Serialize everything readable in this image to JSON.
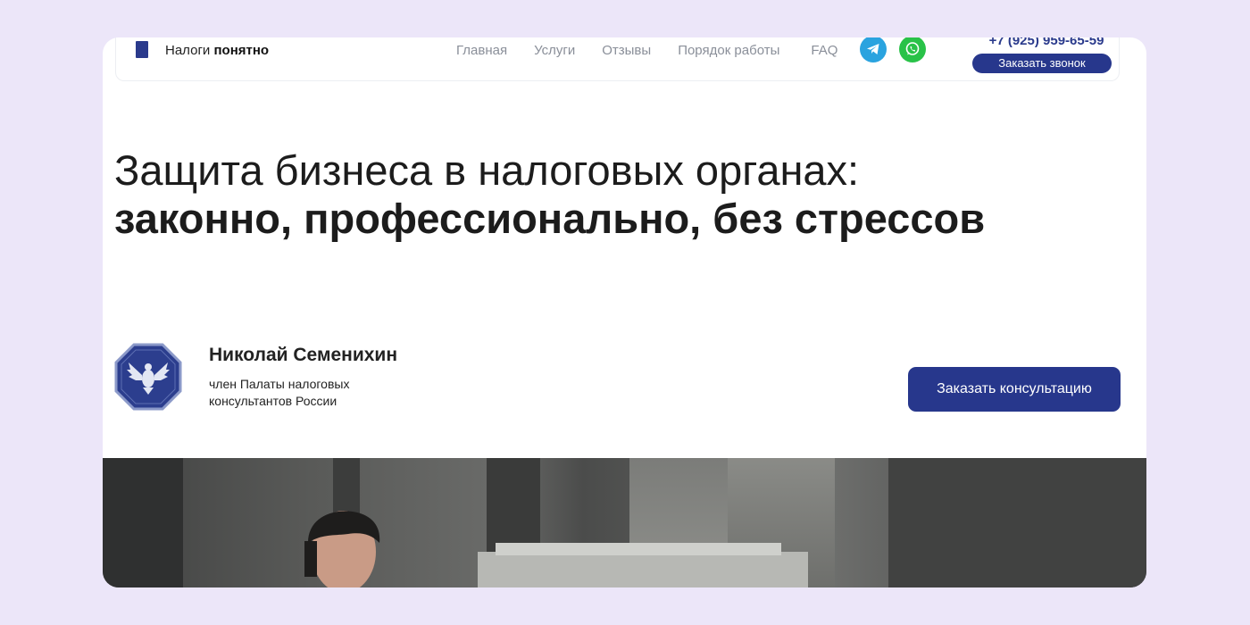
{
  "header": {
    "logo_regular": "Налоги ",
    "logo_bold": "понятно",
    "nav": [
      "Главная",
      "Услуги",
      "Отзывы",
      "Порядок работы",
      "FAQ"
    ],
    "phone": "+7 (925) 959-65-59",
    "call_button": "Заказать звонок",
    "social_icons": [
      "telegram-icon",
      "whatsapp-icon"
    ]
  },
  "hero": {
    "title_line1": "Защита бизнеса в налоговых органах:",
    "title_line2": "законно, профессионально, без стрессов"
  },
  "person": {
    "name": "Николай Семенихин",
    "role_line1": "член Палаты налоговых",
    "role_line2": "консультантов России",
    "badge_icon": "eagle-emblem-icon"
  },
  "cta": {
    "consult_button": "Заказать консультацию"
  },
  "colors": {
    "background": "#ece6f9",
    "accent": "#27378c",
    "telegram": "#2aa3df",
    "whatsapp": "#29c248"
  }
}
